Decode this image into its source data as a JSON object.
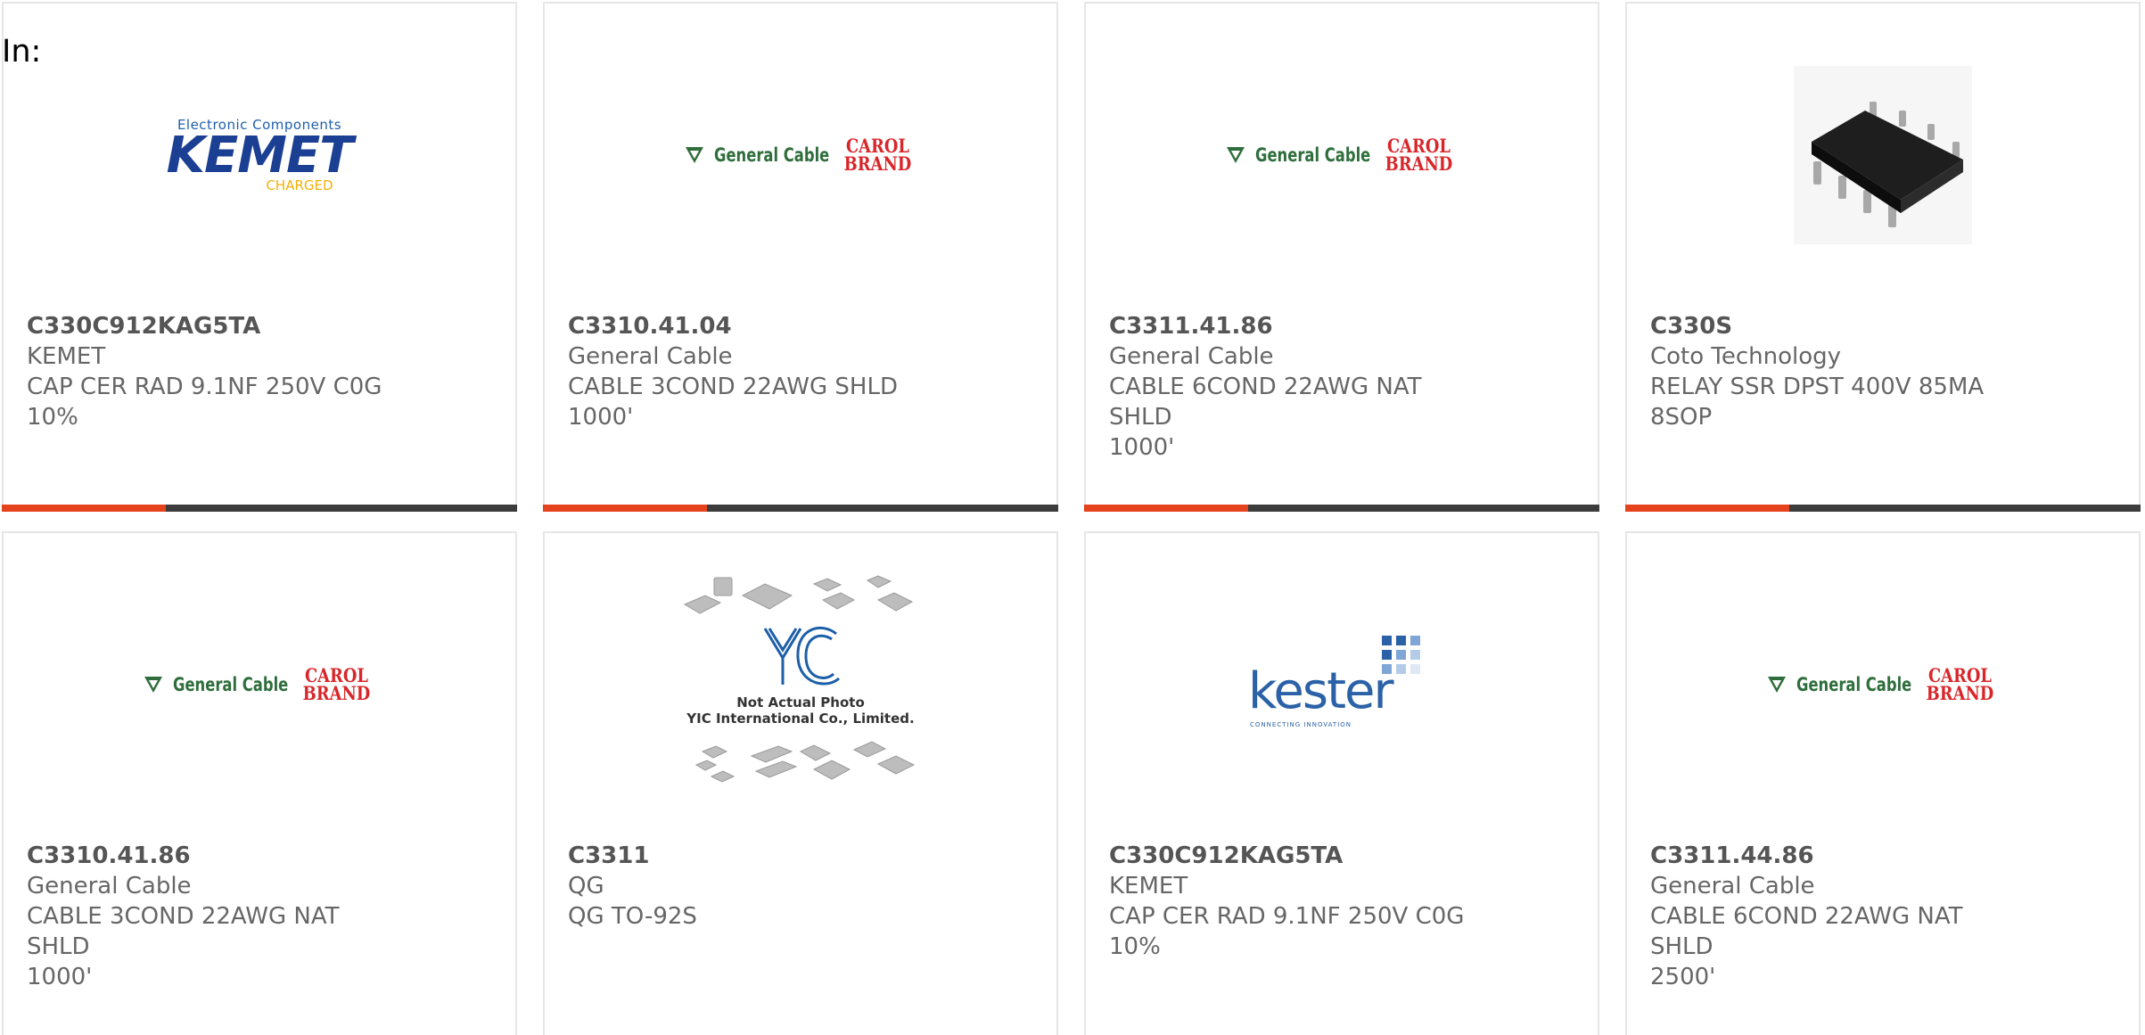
{
  "in_label": "In:",
  "colors": {
    "accent": "#e5421e",
    "bar": "#3c3c3c",
    "card_border": "#e6e6e6",
    "kemet_blue": "#1b3f93",
    "kemet_yellow": "#f2b10a",
    "gc_green": "#2f6e3c",
    "carol_red": "#d8262a",
    "kester_blue": "#2b61a6"
  },
  "logos": {
    "kemet": {
      "top": "Electronic Components",
      "main": "KEMET",
      "bottom": "CHARGED"
    },
    "general_cable": {
      "name": "General Cable",
      "carol_line1": "CAROL",
      "carol_line2": "BRAND"
    },
    "kester": {
      "word": "kester",
      "tag": "CONNECTING INNOVATION"
    },
    "yic": {
      "line1": "Not Actual Photo",
      "line2": "YIC International Co., Limited."
    }
  },
  "products": [
    {
      "part_number": "C330C912KAG5TA",
      "manufacturer": "KEMET",
      "desc_line1": "CAP CER RAD 9.1NF 250V C0G",
      "desc_line2": "10%",
      "image": "kemet-logo"
    },
    {
      "part_number": "C3310.41.04",
      "manufacturer": "General Cable",
      "desc_line1": "CABLE 3COND 22AWG SHLD",
      "desc_line2": "1000'",
      "image": "general-cable-logo"
    },
    {
      "part_number": "C3311.41.86",
      "manufacturer": "General Cable",
      "desc_line1": "CABLE 6COND 22AWG NAT SHLD",
      "desc_line2": "1000'",
      "image": "general-cable-logo"
    },
    {
      "part_number": "C330S",
      "manufacturer": "Coto Technology",
      "desc_line1": "RELAY SSR DPST 400V 85MA",
      "desc_line2": "8SOP",
      "image": "ic-package-photo"
    },
    {
      "part_number": "C3310.41.86",
      "manufacturer": "General Cable",
      "desc_line1": "CABLE 3COND 22AWG NAT SHLD",
      "desc_line2": "1000'",
      "image": "general-cable-logo"
    },
    {
      "part_number": "C3311",
      "manufacturer": "QG",
      "desc_line1": "QG TO-92S",
      "desc_line2": "",
      "image": "yic-placeholder"
    },
    {
      "part_number": "C330C912KAG5TA",
      "manufacturer": "KEMET",
      "desc_line1": "CAP CER RAD 9.1NF 250V C0G",
      "desc_line2": "10%",
      "image": "kester-logo"
    },
    {
      "part_number": "C3311.44.86",
      "manufacturer": "General Cable",
      "desc_line1": "CABLE 6COND 22AWG NAT SHLD",
      "desc_line2": "2500'",
      "image": "general-cable-logo"
    }
  ]
}
